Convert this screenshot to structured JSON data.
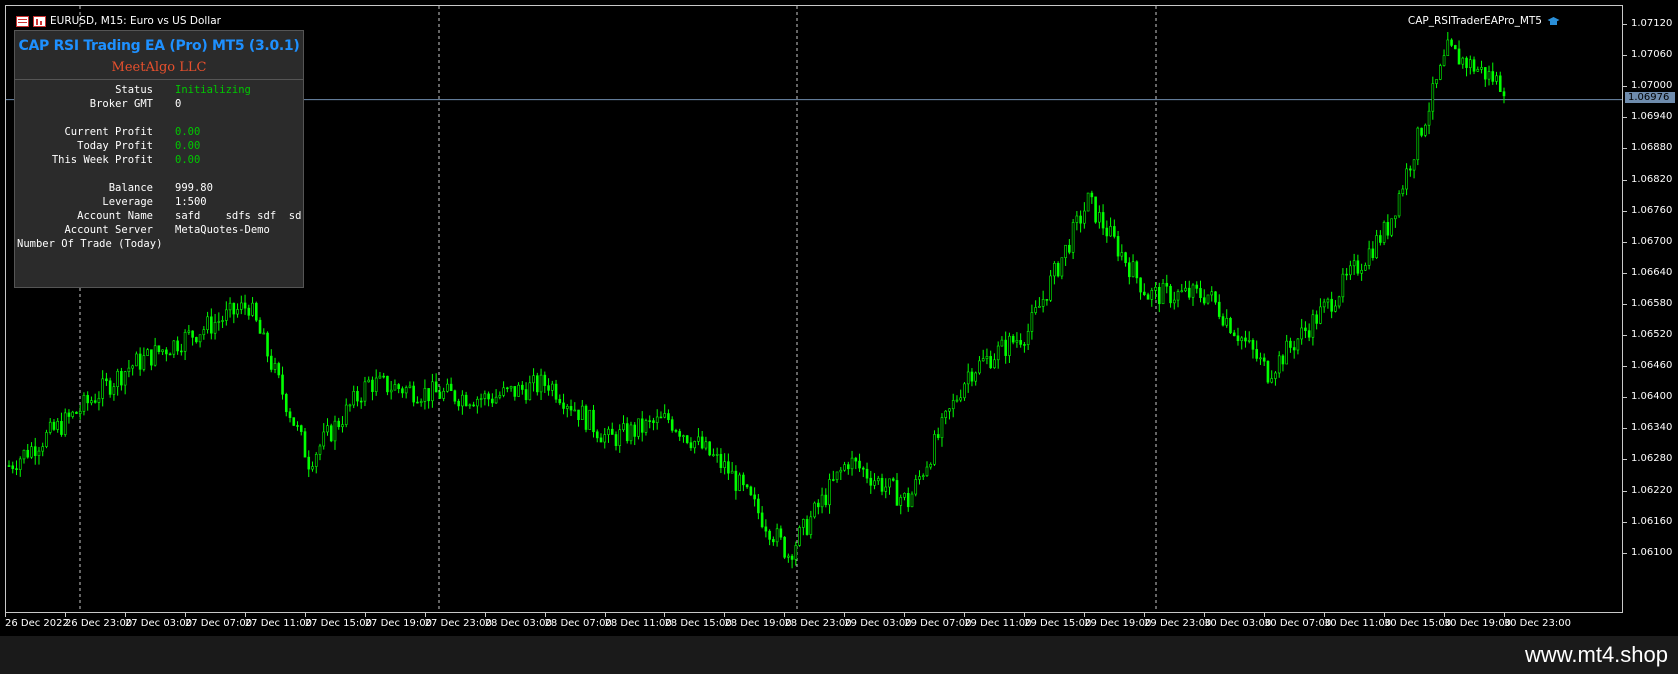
{
  "window": {
    "symbol_title": "EURUSD, M15:  Euro vs US Dollar",
    "ea_name": "CAP_RSITraderEAPro_MT5"
  },
  "panel": {
    "title": "CAP RSI Trading EA (Pro) MT5 (3.0.1)",
    "subtitle": "MeetAlgo LLC",
    "rows": [
      {
        "label": "Status",
        "value": "Initializing",
        "green": true
      },
      {
        "label": "Broker GMT",
        "value": "0",
        "green": false
      },
      {
        "label": "Current Profit",
        "value": "0.00",
        "green": true
      },
      {
        "label": "Today Profit",
        "value": "0.00",
        "green": true
      },
      {
        "label": "This Week Profit",
        "value": "0.00",
        "green": true
      },
      {
        "label": "Balance",
        "value": "999.80",
        "green": false
      },
      {
        "label": "Leverage",
        "value": "1:500",
        "green": false
      },
      {
        "label": "Account Name",
        "value": "safd    sdfs sdf  sd",
        "green": false
      },
      {
        "label": "Account Server",
        "value": "MetaQuotes-Demo",
        "green": false
      },
      {
        "label": "Number Of Trade (Today)",
        "value": "",
        "green": false
      }
    ]
  },
  "price_axis": [
    "1.07120",
    "1.07060",
    "1.07000",
    "1.06940",
    "1.06880",
    "1.06820",
    "1.06760",
    "1.06700",
    "1.06640",
    "1.06580",
    "1.06520",
    "1.06460",
    "1.06400",
    "1.06340",
    "1.06280",
    "1.06220",
    "1.06160",
    "1.06100"
  ],
  "current_price": "1.06976",
  "time_axis": [
    "26 Dec 2022",
    "26 Dec 23:00",
    "27 Dec 03:00",
    "27 Dec 07:00",
    "27 Dec 11:00",
    "27 Dec 15:00",
    "27 Dec 19:00",
    "27 Dec 23:00",
    "28 Dec 03:00",
    "28 Dec 07:00",
    "28 Dec 11:00",
    "28 Dec 15:00",
    "28 Dec 19:00",
    "28 Dec 23:00",
    "29 Dec 03:00",
    "29 Dec 07:00",
    "29 Dec 11:00",
    "29 Dec 15:00",
    "29 Dec 19:00",
    "29 Dec 23:00",
    "30 Dec 03:00",
    "30 Dec 07:00",
    "30 Dec 11:00",
    "30 Dec 15:00",
    "30 Dec 19:00",
    "30 Dec 23:00"
  ],
  "watermark": "www.mt4.shop",
  "colors": {
    "candle": "#00ff00",
    "background": "#000000",
    "panel_title": "#1e90ff",
    "panel_subtitle": "#e8502d",
    "price_line": "#6f8cad"
  },
  "chart_data": {
    "type": "line",
    "title": "EURUSD, M15",
    "ylim": [
      1.0605,
      1.0718
    ],
    "x": [
      "26 Dec 2022",
      "26 Dec 23:00",
      "27 Dec 03:00",
      "27 Dec 07:00",
      "27 Dec 11:00",
      "27 Dec 15:00",
      "27 Dec 19:00",
      "27 Dec 23:00",
      "28 Dec 03:00",
      "28 Dec 07:00",
      "28 Dec 11:00",
      "28 Dec 15:00",
      "28 Dec 19:00",
      "28 Dec 23:00",
      "29 Dec 03:00",
      "29 Dec 07:00",
      "29 Dec 11:00",
      "29 Dec 15:00",
      "29 Dec 19:00",
      "29 Dec 23:00",
      "30 Dec 03:00",
      "30 Dec 07:00",
      "30 Dec 11:00",
      "30 Dec 15:00",
      "30 Dec 19:00",
      "30 Dec 23:00"
    ],
    "series": [
      {
        "values": [
          1.0627,
          1.0636,
          1.0646,
          1.0652,
          1.0658,
          1.0628,
          1.0643,
          1.0641,
          1.064,
          1.0643,
          1.0632,
          1.0636,
          1.0626,
          1.061,
          1.0628,
          1.062,
          1.0645,
          1.0653,
          1.0678,
          1.066,
          1.066,
          1.0645,
          1.0658,
          1.0673,
          1.0707,
          1.07
        ]
      }
    ]
  }
}
